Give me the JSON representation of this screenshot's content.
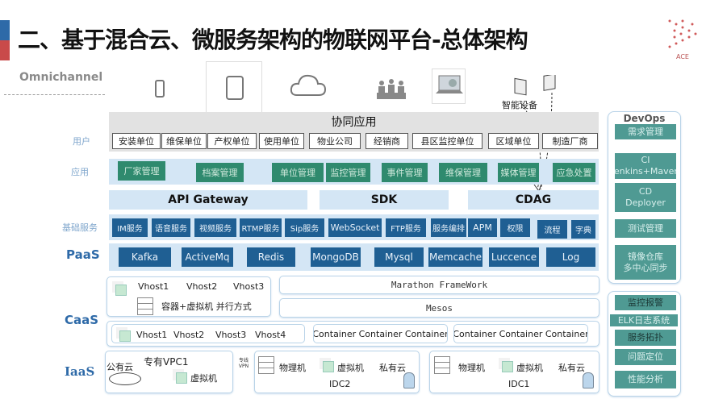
{
  "title": "二、基于混合云、微服务架构的物联网平台-总体架构",
  "logo": "ACE",
  "colors": {
    "blue_bar": "#2e6aa8",
    "red_bar": "#c94a4a",
    "app_green": "#2f8a6e",
    "service_blue": "#1f5f93",
    "devops_teal": "#4f9a93",
    "band": "#d4e6f5"
  },
  "omnichannel": {
    "label": "Omnichannel",
    "icons": [
      "phone-icon",
      "tablet-icon",
      "cloud-icon",
      "people-icon",
      "laptop-icon",
      "smart-device-icon"
    ],
    "smart_device_label": "智能设备"
  },
  "collab": {
    "title": "协同应用",
    "row_label": "用户",
    "users": [
      "安装单位",
      "维保单位",
      "产权单位",
      "使用单位",
      "物业公司",
      "经销商",
      "县区监控单位",
      "区域单位",
      "制造厂商"
    ]
  },
  "apps": {
    "row_label": "应用",
    "items": [
      "厂家管理",
      "档案管理",
      "单位管理",
      "监控管理",
      "事件管理",
      "维保管理",
      "媒体管理",
      "应急处置"
    ]
  },
  "gateway": [
    "API Gateway",
    "SDK",
    "CDAG"
  ],
  "base": {
    "row_label": "基础服务",
    "items": [
      "IM服务",
      "语音服务",
      "视频服务",
      "RTMP服务",
      "Sip服务",
      "WebSocket",
      "FTP服务",
      "服务编排",
      "APM",
      "权限",
      "流程",
      "字典"
    ]
  },
  "paas": {
    "row_label": "PaaS",
    "items": [
      "Kafka",
      "ActiveMq",
      "Redis",
      "MongoDB",
      "Mysql",
      "Memcache",
      "Luccence",
      "Log"
    ]
  },
  "caas": {
    "row_label": "CaaS",
    "vhosts_top": [
      "Vhost1",
      "Vhost2",
      "Vhost3"
    ],
    "mode": "容器+虚拟机 并行方式",
    "marathon": "Marathon FrameWork",
    "mesos": "Mesos",
    "vhosts_bottom": [
      "Vhost1",
      "Vhost2",
      "Vhost3",
      "Vhost4"
    ],
    "containers_a": "Container Container  Container",
    "containers_b": "Container Container  Container"
  },
  "iaas": {
    "row_label": "IaaS",
    "public_cloud": "公有云",
    "vpc": "专有VPC1",
    "vm": "虚拟机",
    "link": "专线 VPN",
    "physical": "物理机",
    "private_cloud": "私有云",
    "idc2": "IDC2",
    "idc1": "IDC1"
  },
  "devops": {
    "title": "DevOps",
    "items": [
      "需求管理",
      "CI\nJenkins+Maven",
      "CD\nDeployer",
      "测试管理",
      "镜像仓库\n多中心同步"
    ]
  },
  "ops": {
    "items": [
      "监控报警",
      "ELK日志系统",
      "服务拓扑",
      "问题定位",
      "性能分析"
    ]
  }
}
